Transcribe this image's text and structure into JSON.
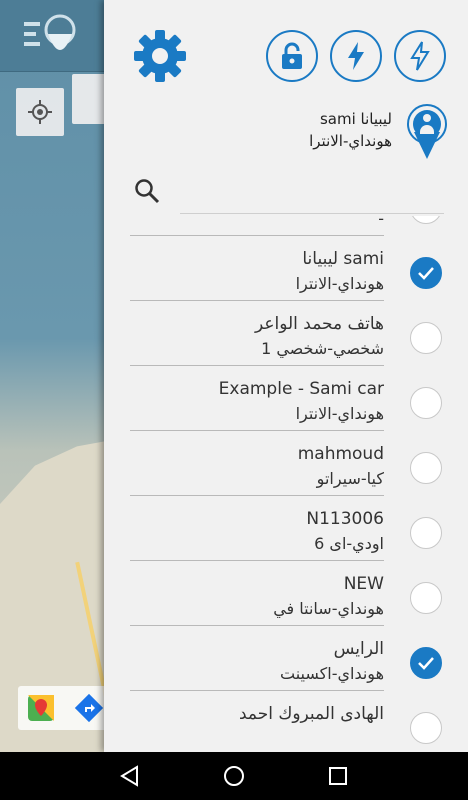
{
  "colors": {
    "accent": "#1a7ac4",
    "app_bar": "#4d7d96",
    "drawer_bg": "#f1f1f1"
  },
  "icons": {
    "app_logo": "location-list-icon",
    "my_location": "crosshair-icon",
    "settings": "gear-icon",
    "lock": "lock-open-icon",
    "flash": "lightning-icon",
    "flash_off": "lightning-off-icon",
    "profile": "person-pin-icon",
    "search": "search-icon",
    "nav_back": "back-triangle-icon",
    "nav_home": "home-circle-icon",
    "nav_recents": "recents-square-icon"
  },
  "profile": {
    "name": "ليبيانا sami",
    "model": "هونداي-الانترا"
  },
  "search": {
    "placeholder": ""
  },
  "vehicles": [
    {
      "title": "",
      "subtitle": "-",
      "checked": false
    },
    {
      "title": "ليبيانا sami",
      "subtitle": "هونداي-الانترا",
      "checked": true
    },
    {
      "title": "هاتف محمد الواعر",
      "subtitle": "شخصي-شخصي 1",
      "checked": false
    },
    {
      "title": "Example - Sami car",
      "subtitle": "هونداي-الانترا",
      "checked": false
    },
    {
      "title": "mahmoud",
      "subtitle": "كيا-سيراتو",
      "checked": false
    },
    {
      "title": "N113006",
      "subtitle": "اودي-اى 6",
      "checked": false
    },
    {
      "title": "NEW",
      "subtitle": "هونداي-سانتا في",
      "checked": false
    },
    {
      "title": "الرايس",
      "subtitle": "هونداي-اكسينت",
      "checked": true
    },
    {
      "title": "الهادى المبروك احمد",
      "subtitle": "",
      "checked": false
    }
  ]
}
